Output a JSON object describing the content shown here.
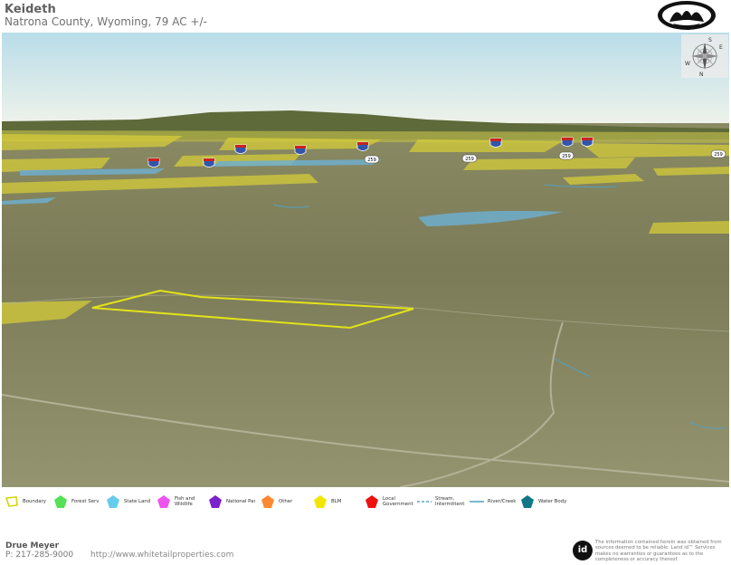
{
  "header": {
    "title": "Keideth",
    "subtitle": "Natrona County, Wyoming, 79 AC +/-"
  },
  "map": {
    "interstate_shield_label": "25",
    "highway_labels": [
      "259",
      "259",
      "259",
      "259"
    ],
    "compass_labels": {
      "n": "N",
      "e": "E",
      "s": "S",
      "w": "W"
    }
  },
  "legend": {
    "items": [
      {
        "label": "Boundary",
        "color": "#d4d400"
      },
      {
        "label": "Forest Service",
        "color": "#55e055"
      },
      {
        "label": "State Land",
        "color": "#66ccee"
      },
      {
        "label": "Fish and\nWildlife",
        "color": "#ee55ee"
      },
      {
        "label": "National Park",
        "color": "#7a22cc"
      },
      {
        "label": "Other",
        "color": "#ff8833"
      },
      {
        "label": "BLM",
        "color": "#f2e600"
      },
      {
        "label": "Local\nGovernment",
        "color": "#ee1111"
      },
      {
        "label": "Stream,\nIntermittent",
        "color": "#3399bb"
      },
      {
        "label": "River/Creek",
        "color": "#2288aa"
      },
      {
        "label": "Water Body",
        "color": "#117788"
      }
    ]
  },
  "footer": {
    "agent_name": "Drue Meyer",
    "phone": "P: 217-285-9000",
    "url": "http://www.whitetailproperties.com",
    "id_logo_text": "id",
    "disclaimer": "The information contained herein was obtained from sources deemed to be reliable. Land id™ Services makes no warranties or guarantees as to the completeness or accuracy thereof."
  }
}
